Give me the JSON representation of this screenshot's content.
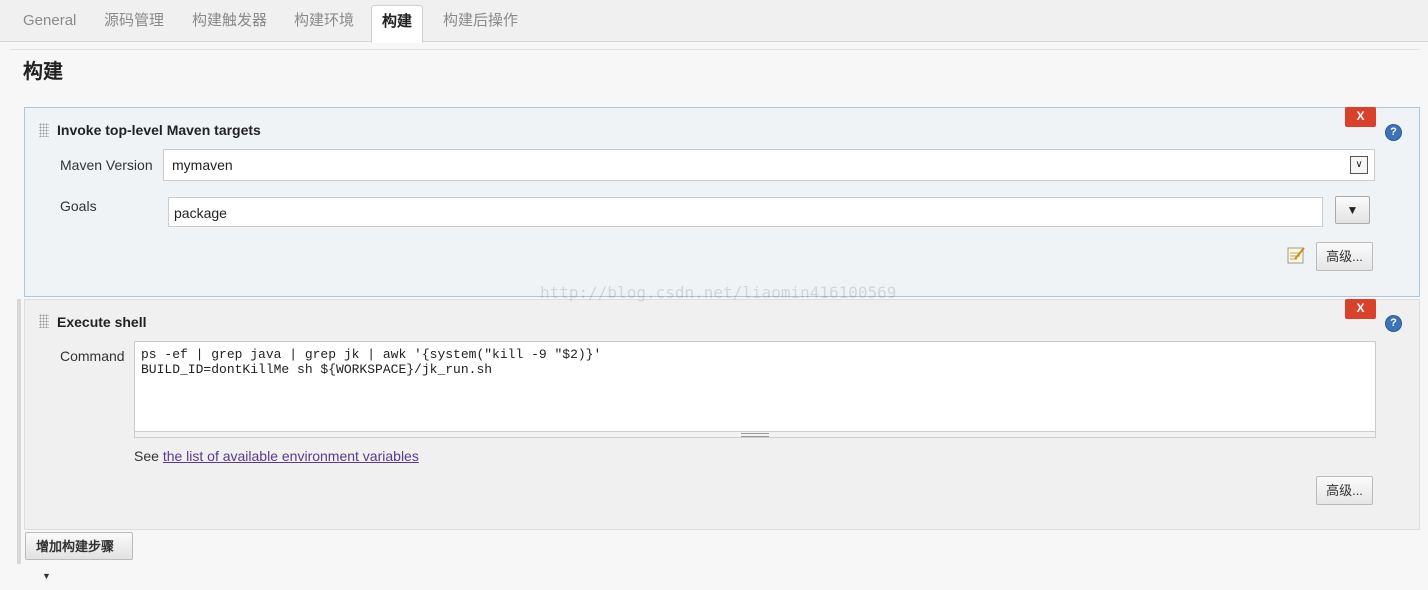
{
  "tabs": [
    "General",
    "源码管理",
    "构建触发器",
    "构建环境",
    "构建",
    "构建后操作"
  ],
  "active_tab": "构建",
  "section_title": "构建",
  "steps": {
    "maven": {
      "title": "Invoke top-level Maven targets",
      "delete_label": "X",
      "help_label": "?",
      "maven_version_label": "Maven Version",
      "maven_version_value": "mymaven",
      "goals_label": "Goals",
      "goals_value": "package",
      "dropdown_label": "▼",
      "advanced_label": "高级..."
    },
    "shell": {
      "title": "Execute shell",
      "delete_label": "X",
      "help_label": "?",
      "command_label": "Command",
      "command_line1": "ps -ef | grep java | grep jk | awk '{system(\"kill -9 \"$2)}'",
      "command_line2": "BUILD_ID=dontKillMe sh ${WORKSPACE}/jk_run.sh",
      "see_prefix": "See ",
      "see_link": "the list of available environment variables",
      "advanced_label": "高级..."
    }
  },
  "add_step_label": "增加构建步骤",
  "watermark": "http://blog.csdn.net/liaomin416100569",
  "colors": {
    "delete": "#d9412a",
    "help": "#3b73b5",
    "link": "#5b3a8c"
  },
  "icons": [
    "grip-icon",
    "help-icon",
    "notepad-icon",
    "chevron-down-icon"
  ]
}
